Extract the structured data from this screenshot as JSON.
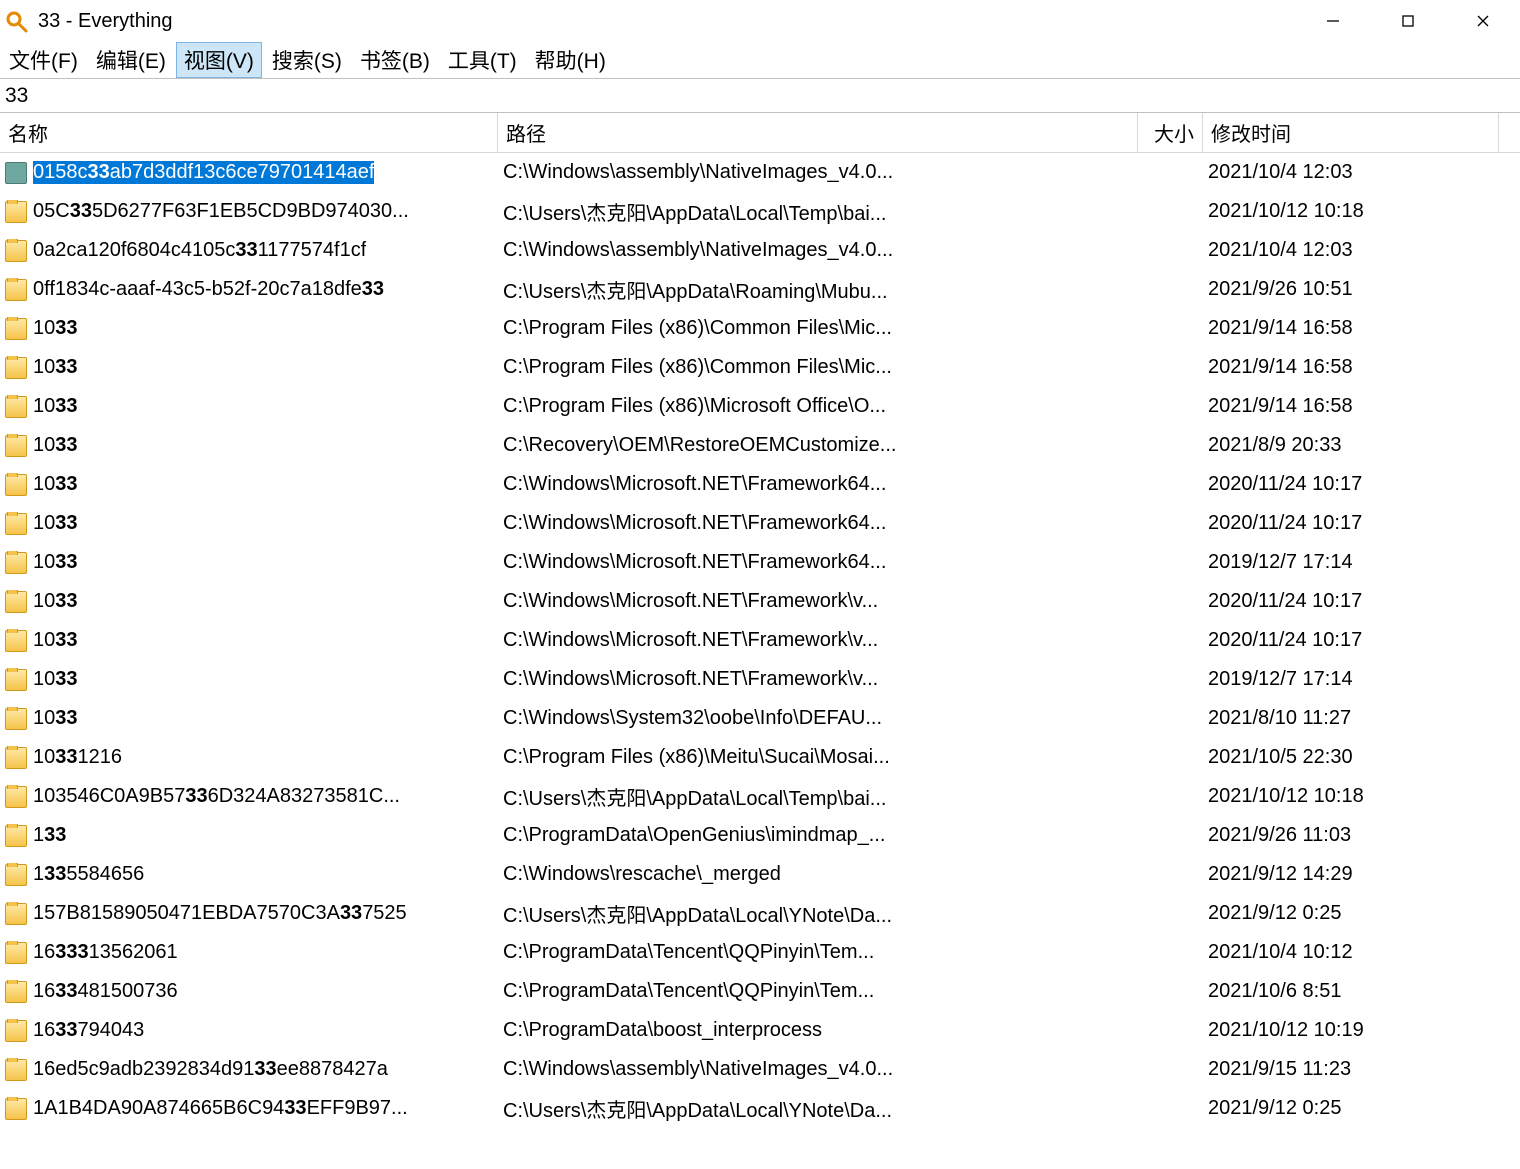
{
  "window": {
    "title": "33 - Everything"
  },
  "menu": {
    "file": "文件(F)",
    "edit": "编辑(E)",
    "view": "视图(V)",
    "search": "搜索(S)",
    "bookmarks": "书签(B)",
    "tools": "工具(T)",
    "help": "帮助(H)"
  },
  "search": {
    "value": "33"
  },
  "columns": {
    "name": "名称",
    "path": "路径",
    "size": "大小",
    "date": "修改时间"
  },
  "search_term": "33",
  "rows": [
    {
      "icon": "dll",
      "name_pre": "0158c",
      "name_hit": "33",
      "name_post": "ab7d3ddf13c6ce79701414aef",
      "name_trunc": false,
      "path": "C:\\Windows\\assembly\\NativeImages_v4.0...",
      "size": "",
      "date": "2021/10/4 12:03",
      "selected": true
    },
    {
      "icon": "folder",
      "name_pre": "05C",
      "name_hit": "33",
      "name_post": "5D6277F63F1EB5CD9BD974030...",
      "name_trunc": true,
      "path": "C:\\Users\\杰克阳\\AppData\\Local\\Temp\\bai...",
      "size": "",
      "date": "2021/10/12 10:18",
      "selected": false
    },
    {
      "icon": "folder",
      "name_pre": "0a2ca120f6804c4105c",
      "name_hit": "33",
      "name_post": "1177574f1cf",
      "name_trunc": false,
      "path": "C:\\Windows\\assembly\\NativeImages_v4.0...",
      "size": "",
      "date": "2021/10/4 12:03",
      "selected": false
    },
    {
      "icon": "folder",
      "name_pre": "0ff1834c-aaaf-43c5-b52f-20c7a18dfe",
      "name_hit": "33",
      "name_post": "",
      "name_trunc": false,
      "path": "C:\\Users\\杰克阳\\AppData\\Roaming\\Mubu...",
      "size": "",
      "date": "2021/9/26 10:51",
      "selected": false
    },
    {
      "icon": "folder",
      "name_pre": "10",
      "name_hit": "33",
      "name_post": "",
      "name_trunc": false,
      "path": "C:\\Program Files (x86)\\Common Files\\Mic...",
      "size": "",
      "date": "2021/9/14 16:58",
      "selected": false
    },
    {
      "icon": "folder",
      "name_pre": "10",
      "name_hit": "33",
      "name_post": "",
      "name_trunc": false,
      "path": "C:\\Program Files (x86)\\Common Files\\Mic...",
      "size": "",
      "date": "2021/9/14 16:58",
      "selected": false
    },
    {
      "icon": "folder",
      "name_pre": "10",
      "name_hit": "33",
      "name_post": "",
      "name_trunc": false,
      "path": "C:\\Program Files (x86)\\Microsoft Office\\O...",
      "size": "",
      "date": "2021/9/14 16:58",
      "selected": false
    },
    {
      "icon": "folder",
      "name_pre": "10",
      "name_hit": "33",
      "name_post": "",
      "name_trunc": false,
      "path": "C:\\Recovery\\OEM\\RestoreOEMCustomize...",
      "size": "",
      "date": "2021/8/9 20:33",
      "selected": false
    },
    {
      "icon": "folder",
      "name_pre": "10",
      "name_hit": "33",
      "name_post": "",
      "name_trunc": false,
      "path": "C:\\Windows\\Microsoft.NET\\Framework64...",
      "size": "",
      "date": "2020/11/24 10:17",
      "selected": false
    },
    {
      "icon": "folder",
      "name_pre": "10",
      "name_hit": "33",
      "name_post": "",
      "name_trunc": false,
      "path": "C:\\Windows\\Microsoft.NET\\Framework64...",
      "size": "",
      "date": "2020/11/24 10:17",
      "selected": false
    },
    {
      "icon": "folder",
      "name_pre": "10",
      "name_hit": "33",
      "name_post": "",
      "name_trunc": false,
      "path": "C:\\Windows\\Microsoft.NET\\Framework64...",
      "size": "",
      "date": "2019/12/7 17:14",
      "selected": false
    },
    {
      "icon": "folder",
      "name_pre": "10",
      "name_hit": "33",
      "name_post": "",
      "name_trunc": false,
      "path": "C:\\Windows\\Microsoft.NET\\Framework\\v...",
      "size": "",
      "date": "2020/11/24 10:17",
      "selected": false
    },
    {
      "icon": "folder",
      "name_pre": "10",
      "name_hit": "33",
      "name_post": "",
      "name_trunc": false,
      "path": "C:\\Windows\\Microsoft.NET\\Framework\\v...",
      "size": "",
      "date": "2020/11/24 10:17",
      "selected": false
    },
    {
      "icon": "folder",
      "name_pre": "10",
      "name_hit": "33",
      "name_post": "",
      "name_trunc": false,
      "path": "C:\\Windows\\Microsoft.NET\\Framework\\v...",
      "size": "",
      "date": "2019/12/7 17:14",
      "selected": false
    },
    {
      "icon": "folder",
      "name_pre": "10",
      "name_hit": "33",
      "name_post": "",
      "name_trunc": false,
      "path": "C:\\Windows\\System32\\oobe\\Info\\DEFAU...",
      "size": "",
      "date": "2021/8/10 11:27",
      "selected": false
    },
    {
      "icon": "folder",
      "name_pre": "10",
      "name_hit": "33",
      "name_post": "1216",
      "name_trunc": false,
      "path": "C:\\Program Files (x86)\\Meitu\\Sucai\\Mosai...",
      "size": "",
      "date": "2021/10/5 22:30",
      "selected": false
    },
    {
      "icon": "folder",
      "name_pre": "103546C0A9B57",
      "name_hit": "33",
      "name_post": "6D324A83273581C...",
      "name_trunc": true,
      "path": "C:\\Users\\杰克阳\\AppData\\Local\\Temp\\bai...",
      "size": "",
      "date": "2021/10/12 10:18",
      "selected": false
    },
    {
      "icon": "folder",
      "name_pre": "1",
      "name_hit": "33",
      "name_post": "",
      "name_trunc": false,
      "path": "C:\\ProgramData\\OpenGenius\\imindmap_...",
      "size": "",
      "date": "2021/9/26 11:03",
      "selected": false
    },
    {
      "icon": "folder",
      "name_pre": "1",
      "name_hit": "33",
      "name_post": "5584656",
      "name_trunc": false,
      "path": "C:\\Windows\\rescache\\_merged",
      "size": "",
      "date": "2021/9/12 14:29",
      "selected": false
    },
    {
      "icon": "folder",
      "name_pre": "157B81589050471EBDA7570C3A",
      "name_hit": "33",
      "name_post": "7525",
      "name_trunc": false,
      "path": "C:\\Users\\杰克阳\\AppData\\Local\\YNote\\Da...",
      "size": "",
      "date": "2021/9/12 0:25",
      "selected": false
    },
    {
      "icon": "folder",
      "name_pre": "16",
      "name_hit": "333",
      "name_post": "13562061",
      "name_trunc": false,
      "path": "C:\\ProgramData\\Tencent\\QQPinyin\\Tem...",
      "size": "",
      "date": "2021/10/4 10:12",
      "selected": false
    },
    {
      "icon": "folder",
      "name_pre": "16",
      "name_hit": "33",
      "name_post": "481500736",
      "name_trunc": false,
      "path": "C:\\ProgramData\\Tencent\\QQPinyin\\Tem...",
      "size": "",
      "date": "2021/10/6 8:51",
      "selected": false
    },
    {
      "icon": "folder",
      "name_pre": "16",
      "name_hit": "33",
      "name_post": "794043",
      "name_trunc": false,
      "path": "C:\\ProgramData\\boost_interprocess",
      "size": "",
      "date": "2021/10/12 10:19",
      "selected": false
    },
    {
      "icon": "folder",
      "name_pre": "16ed5c9adb2392834d91",
      "name_hit": "33",
      "name_post": "ee8878427a",
      "name_trunc": false,
      "path": "C:\\Windows\\assembly\\NativeImages_v4.0...",
      "size": "",
      "date": "2021/9/15 11:23",
      "selected": false
    },
    {
      "icon": "folder",
      "name_pre": "1A1B4DA90A874665B6C94",
      "name_hit": "33",
      "name_post": "EFF9B97...",
      "name_trunc": true,
      "path": "C:\\Users\\杰克阳\\AppData\\Local\\YNote\\Da...",
      "size": "",
      "date": "2021/9/12 0:25",
      "selected": false
    }
  ]
}
